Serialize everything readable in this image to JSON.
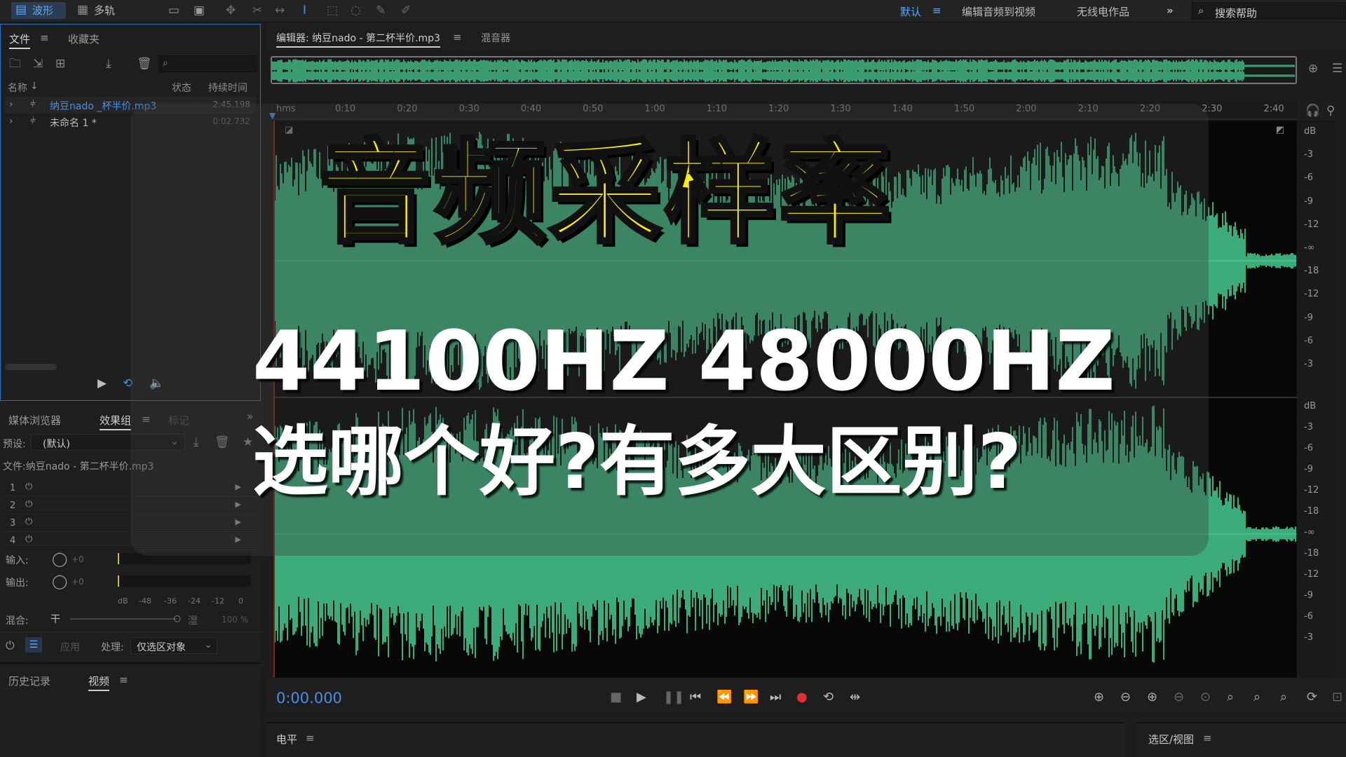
{
  "toolbar": {
    "mode_waveform": "波形",
    "mode_multitrack": "多轨",
    "workspace_default": "默认",
    "workspace_edit_video": "编辑音频到视频",
    "workspace_radio": "无线电作品",
    "search_help_placeholder": "搜索帮助"
  },
  "files_panel": {
    "tab_files": "文件",
    "tab_favorites": "收藏夹",
    "col_name": "名称",
    "col_status": "状态",
    "col_duration": "持续时间",
    "rows": [
      {
        "name": "纳豆nado _杯半价.mp3",
        "duration": "2:45.198"
      },
      {
        "name": "未命名 1 *",
        "duration": "0:02.732"
      }
    ]
  },
  "effects_panel": {
    "tab_media_browser": "媒体浏览器",
    "tab_effects_rack": "效果组",
    "tab_markers": "标记",
    "preset_label": "预设:",
    "preset_value": "(默认)",
    "file_label": "文件:纳豆nado - 第二杯半价.mp3",
    "rack_rows": [
      "1",
      "2",
      "3",
      "4"
    ],
    "input_label": "输入:",
    "output_label": "输出:",
    "input_gain": "+0",
    "output_gain": "+0",
    "meter_ticks": [
      "dB",
      "-48",
      "-36",
      "-24",
      "-12",
      "0"
    ],
    "mix_label": "混合:",
    "mix_dry": "干",
    "mix_wet": "湿",
    "mix_percent": "100 %",
    "apply_button": "应用",
    "process_label": "处理:",
    "process_value": "仅选区对象"
  },
  "history_panel": {
    "tab_history": "历史记录",
    "tab_video": "视频"
  },
  "editor": {
    "tab_editor": "编辑器: 纳豆nado - 第二杯半价.mp3",
    "tab_mixer": "混音器",
    "ruler_unit": "hms",
    "ruler_ticks": [
      "0:10",
      "0:20",
      "0:30",
      "0:40",
      "0:50",
      "1:00",
      "1:10",
      "1:20",
      "1:30",
      "1:40",
      "1:50",
      "2:00",
      "2:10",
      "2:20",
      "2:30",
      "2:40"
    ],
    "db_top": [
      "dB",
      "-3",
      "-6",
      "-9",
      "-12",
      "-∞",
      "-18",
      "-12",
      "-9",
      "-6",
      "-3"
    ],
    "db_bottom": [
      "dB",
      "-3",
      "-6",
      "-9",
      "-12",
      "-18",
      "-∞",
      "-18",
      "-12",
      "-9",
      "-6",
      "-3"
    ],
    "waveform_color": "#48d596"
  },
  "transport": {
    "time": "0:00.000",
    "record_color": "#e0302f"
  },
  "level_panel": {
    "title": "电平"
  },
  "selview_panel": {
    "title": "选区/视图"
  },
  "overlay": {
    "title_main": "音频采样率",
    "title_freq": "44100HZ 48000HZ",
    "title_question": "选哪个好?有多大区别?",
    "title_color": "#f8ec14"
  }
}
